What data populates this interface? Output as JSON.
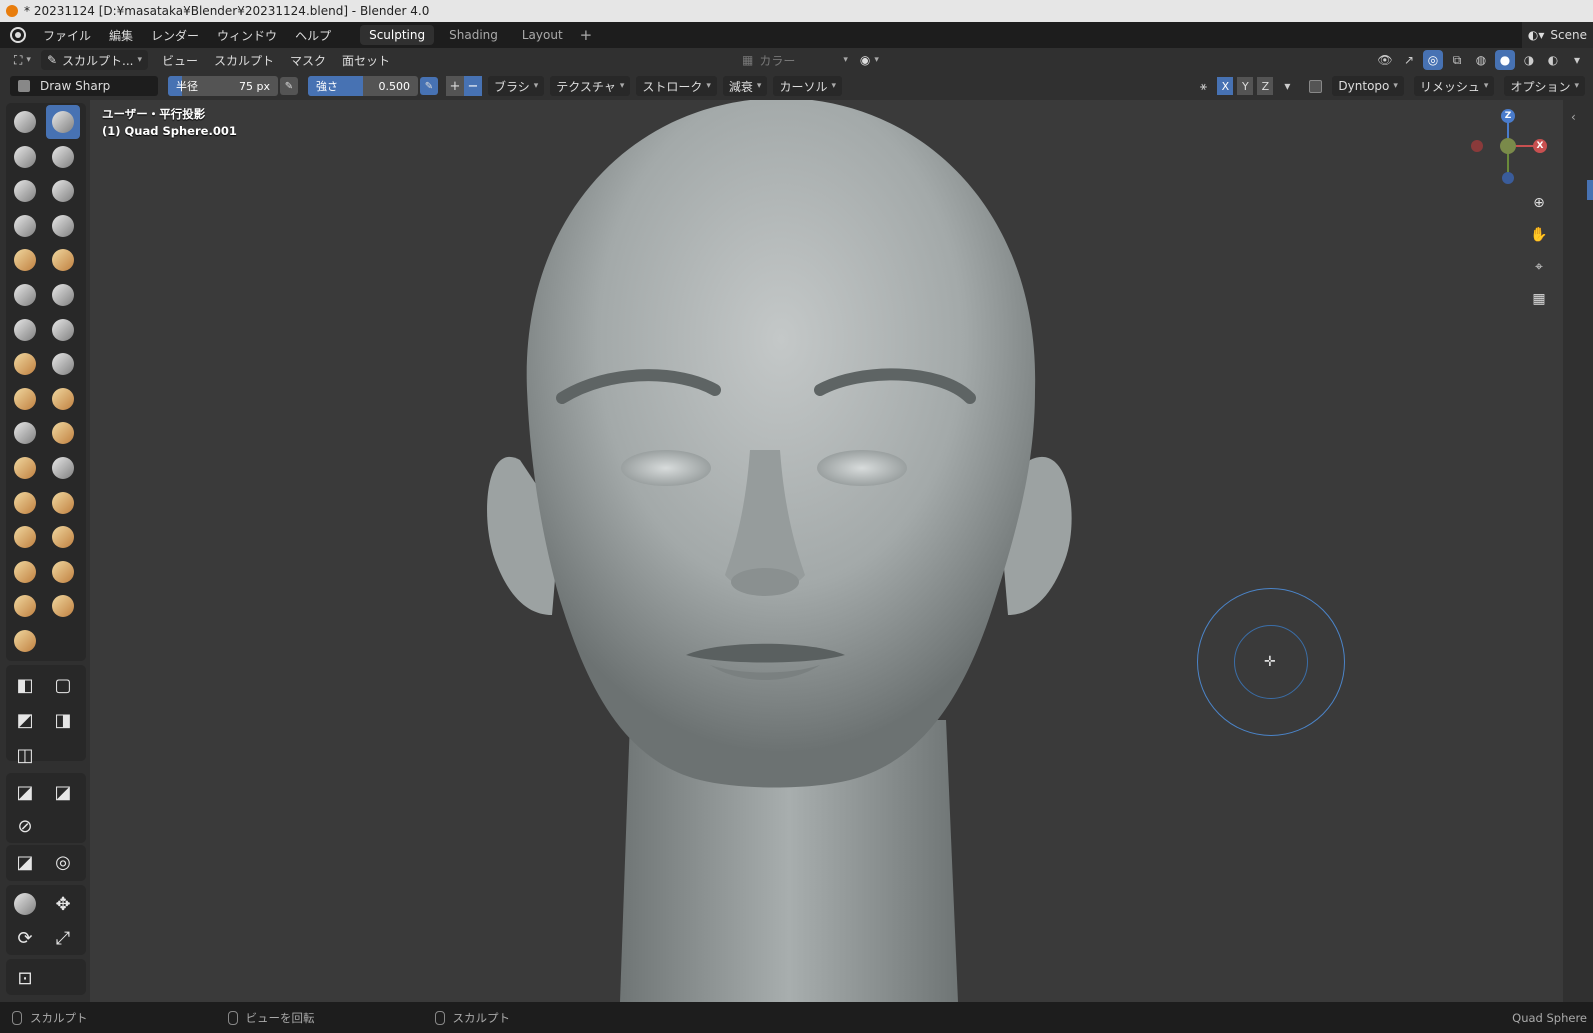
{
  "window": {
    "title": "* 20231124 [D:¥masataka¥Blender¥20231124.blend] - Blender 4.0"
  },
  "menu": {
    "items": [
      "ファイル",
      "編集",
      "レンダー",
      "ウィンドウ",
      "ヘルプ"
    ],
    "workspaces": [
      "Sculpting",
      "Shading",
      "Layout"
    ],
    "active_workspace": "Sculpting",
    "add_tab": "+",
    "scene": "Scene"
  },
  "header": {
    "mode": "スカルプト...",
    "menus": [
      "ビュー",
      "スカルプト",
      "マスク",
      "面セット"
    ],
    "color_attr": "カラー"
  },
  "tool_settings": {
    "brush_name": "Draw Sharp",
    "radius": {
      "label": "半径",
      "value": "75 px"
    },
    "strength": {
      "label": "強さ",
      "value": "0.500",
      "fraction": 0.5
    },
    "plus": "+",
    "minus": "−",
    "dropdowns": [
      "ブラシ",
      "テクスチャ",
      "ストローク",
      "減衰",
      "カーソル"
    ],
    "axes": [
      "X",
      "Y",
      "Z"
    ],
    "dyntopo": "Dyntopo",
    "remesh": "リメッシュ",
    "options": "オプション"
  },
  "viewport": {
    "view_label": "ユーザー・平行投影",
    "object_label": "(1) Quad Sphere.001",
    "gizmo": {
      "z": "Z",
      "x": "X"
    }
  },
  "toolbar": {
    "icons": [
      "draw",
      "draw-sharp",
      "clay",
      "clay-strips",
      "clay-thumb",
      "layer",
      "inflate",
      "blob",
      "crease",
      "smooth",
      "flatten",
      "fill",
      "scrape",
      "multiplane-scrape",
      "pinch",
      "grab",
      "elastic-deform",
      "snake-hook",
      "thumb",
      "pose",
      "nudge",
      "rotate",
      "slide-relax",
      "boundary",
      "cloth",
      "simplify",
      "mask",
      "draw-face-sets",
      "multires-displacement-eraser",
      "multires-smear",
      "paint",
      "smear",
      "box-mask",
      "lasso-mask",
      "box-hide",
      "box-face-set",
      "line-project",
      "mesh-filter",
      "cloth-filter",
      "color-filter",
      "edit-face-set",
      "mask-by-color",
      "move",
      "rotate-transform",
      "scale",
      "transform",
      "annotate"
    ]
  },
  "statusbar": {
    "items": [
      "スカルプト",
      "ビューを回転",
      "スカルプト"
    ],
    "right": "Quad Sphere"
  },
  "colors": {
    "accent": "#4772b3",
    "bg": "#303030",
    "viewport": "#3a3a3a"
  }
}
